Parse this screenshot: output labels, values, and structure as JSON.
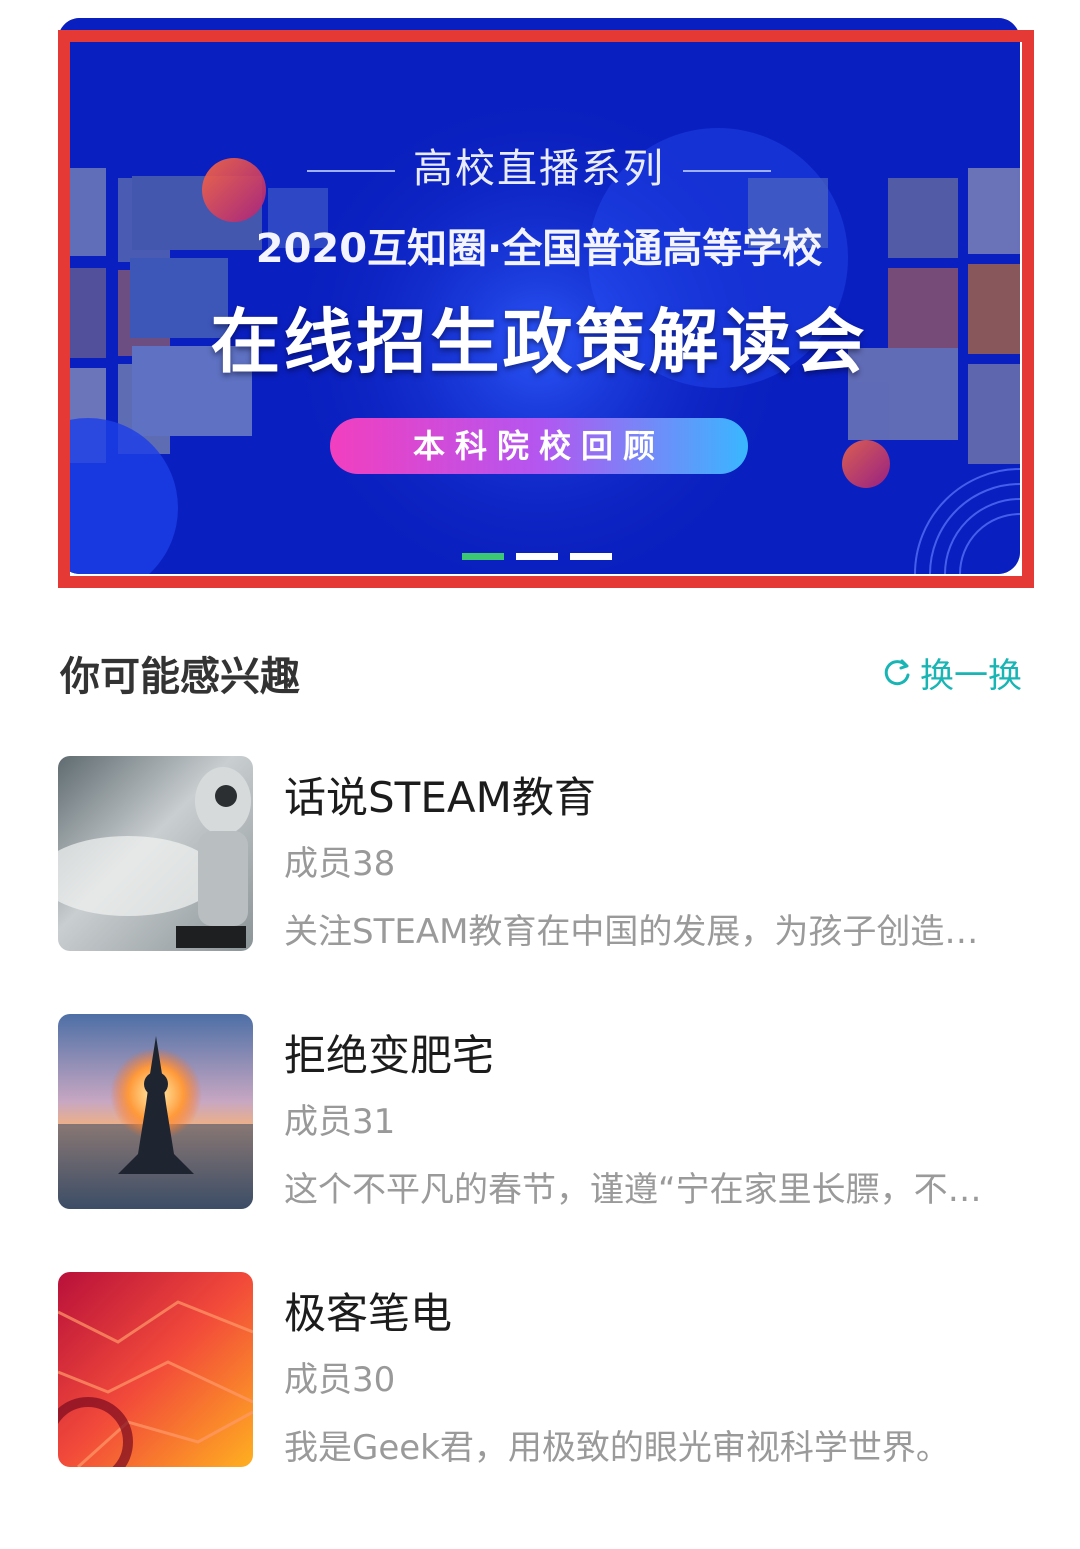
{
  "banner": {
    "series_label": "高校直播系列",
    "subtitle": "2020互知圈·全国普通高等学校",
    "title": "在线招生政策解读会",
    "button_label": "本科院校回顾",
    "slide_count": 3,
    "active_slide": 1,
    "colors": {
      "background": "#0a24d6",
      "frame": "#e53935",
      "active_dot": "#3cc775"
    }
  },
  "section": {
    "title": "你可能感兴趣",
    "refresh_label": "换一换",
    "refresh_icon": "refresh-icon",
    "accent_color": "#19b5b5"
  },
  "groups": [
    {
      "name": "话说STEAM教育",
      "members": "成员38",
      "description": "关注STEAM教育在中国的发展，为孩子创造…",
      "image": "robot-thumbnail"
    },
    {
      "name": "拒绝变肥宅",
      "members": "成员31",
      "description": "这个不平凡的春节，谨遵“宁在家里长膘，不…",
      "image": "yoga-sunset-thumbnail"
    },
    {
      "name": "极客笔电",
      "members": "成员30",
      "description": " 我是Geek君，用极致的眼光审视科学世界。",
      "image": "geek-red-thumbnail"
    }
  ]
}
